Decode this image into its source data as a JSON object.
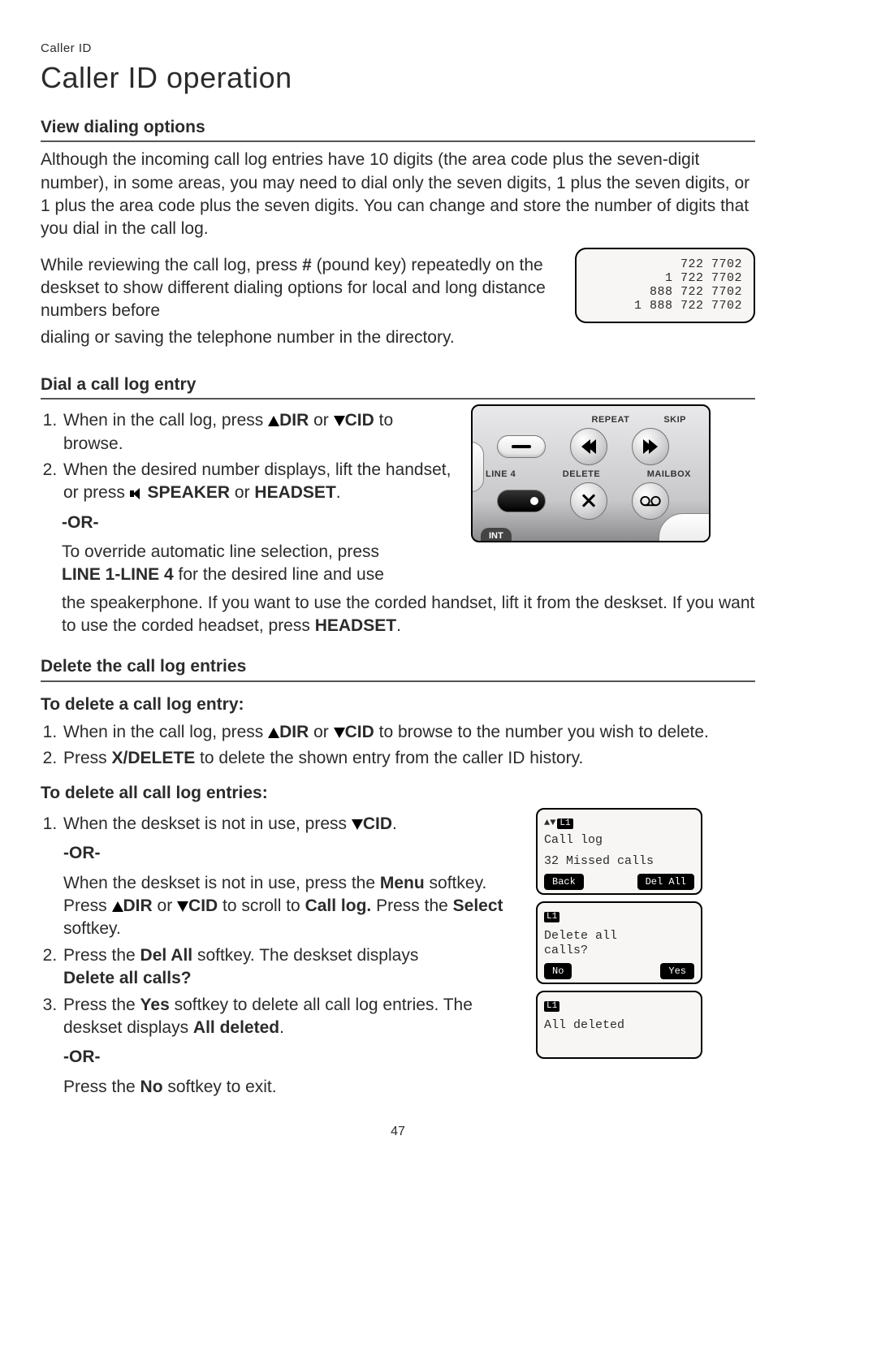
{
  "header": {
    "toplabel": "Caller ID",
    "title": "Caller ID operation"
  },
  "s1": {
    "heading": "View dialing options",
    "p1": "Although the incoming call log entries have 10 digits (the area code plus the seven-digit number), in some areas, you may need to dial only the seven digits, 1 plus the seven digits, or 1 plus the area code plus the seven digits. You can change and store the number of digits that you dial in the call log.",
    "p2a": "While reviewing the call log, press ",
    "p2b": " (pound key) repeatedly on the deskset to show different dialing options for local and long distance numbers before",
    "pound": "#",
    "p3": "dialing or saving the telephone number in the directory."
  },
  "lcd1": {
    "l1": "722 7702",
    "l2": "1 722 7702",
    "l3": "888 722 7702",
    "l4": "1 888 722 7702"
  },
  "s2": {
    "heading": "Dial a call log entry",
    "step1a": "When in the call log, press ",
    "step1b": " or ",
    "step1c": " to browse.",
    "dir": "DIR",
    "cid": "CID",
    "step2a": "When the desired number displays, lift the handset, or press ",
    "step2b": " or ",
    "step2c": ".",
    "speaker": "SPEAKER",
    "headset": "HEADSET",
    "or": "-OR-",
    "over1": "To override automatic line selection, press ",
    "over2": " for the desired line and use",
    "lines": "LINE 1-LINE 4",
    "over3a": "the speakerphone. If you want to use the corded handset, lift it from the deskset. If you want to use the corded headset, press ",
    "over3b": "."
  },
  "panel": {
    "repeat": "REPEAT",
    "skip": "SKIP",
    "line4": "LINE 4",
    "delete": "DELETE",
    "mailbox": "MAILBOX",
    "int": "INT"
  },
  "s3": {
    "heading": "Delete the call log entries",
    "sub1": "To delete a call log entry:",
    "d1a": "When in the call log, press ",
    "d1b": " or ",
    "d1c": " to browse to the number you wish to delete.",
    "d2a": "Press ",
    "d2b": " to delete the shown entry from the caller ID history.",
    "xdel": "X/DELETE",
    "sub2": "To delete all call log entries:",
    "e1a": "When the deskset is not in use, press ",
    "e1b": ".",
    "or": "-OR-",
    "e1c1": "When the deskset is not in use, press the ",
    "e1c2": " softkey. Press ",
    "e1c3": " or ",
    "e1c4": " to scroll to ",
    "e1c5": " Press the ",
    "e1c6": " softkey.",
    "menu": "Menu",
    "calllog": "Call log.",
    "select": "Select",
    "e2a": "Press the ",
    "e2b": " softkey. The deskset displays ",
    "delall": "Del All",
    "delallq": "Delete all calls?",
    "e3a": "Press the ",
    "e3b": " softkey to delete all call log entries. The deskset displays ",
    "e3c": ".",
    "yes": "Yes",
    "alldel": "All deleted",
    "e4a": "Press the ",
    "e4b": " softkey to exit.",
    "no": "No"
  },
  "lcdA": {
    "l1": "L1",
    "title": "Call log",
    "body": "32 Missed calls",
    "left": "Back",
    "right": "Del All"
  },
  "lcdB": {
    "l1": "L1",
    "body": "Delete all\ncalls?",
    "left": "No",
    "right": "Yes"
  },
  "lcdC": {
    "l1": "L1",
    "body": "All deleted"
  },
  "pagenum": "47"
}
